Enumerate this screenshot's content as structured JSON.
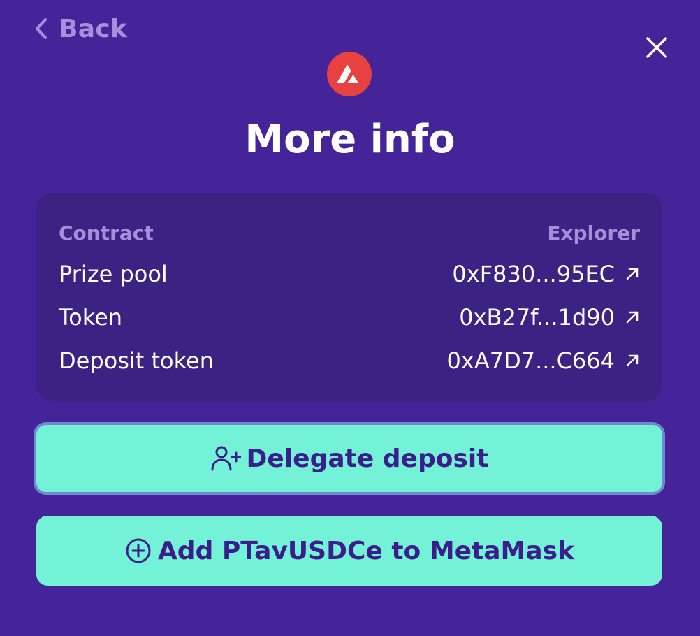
{
  "nav": {
    "back_label": "Back",
    "back_icon": "chevron-left-icon",
    "close_icon": "close-icon"
  },
  "network": {
    "logo_icon": "avalanche-logo-icon",
    "logo_color": "#e84142"
  },
  "title": "More info",
  "contracts": {
    "header_left": "Contract",
    "header_right": "Explorer",
    "rows": [
      {
        "label": "Prize pool",
        "address": "0xF830...95EC",
        "icon": "external-link-icon"
      },
      {
        "label": "Token",
        "address": "0xB27f...1d90",
        "icon": "external-link-icon"
      },
      {
        "label": "Deposit token",
        "address": "0xA7D7...C664",
        "icon": "external-link-icon"
      }
    ]
  },
  "actions": {
    "delegate_label": "Delegate deposit",
    "delegate_icon": "user-plus-icon",
    "add_token_label": "Add PTavUSDCe to MetaMask",
    "add_token_icon": "plus-circle-icon"
  },
  "colors": {
    "background": "#45249a",
    "card": "#3b2283",
    "accent": "#74f2d8",
    "button_text": "#3b1d8c",
    "muted_text": "#a68fd9"
  }
}
